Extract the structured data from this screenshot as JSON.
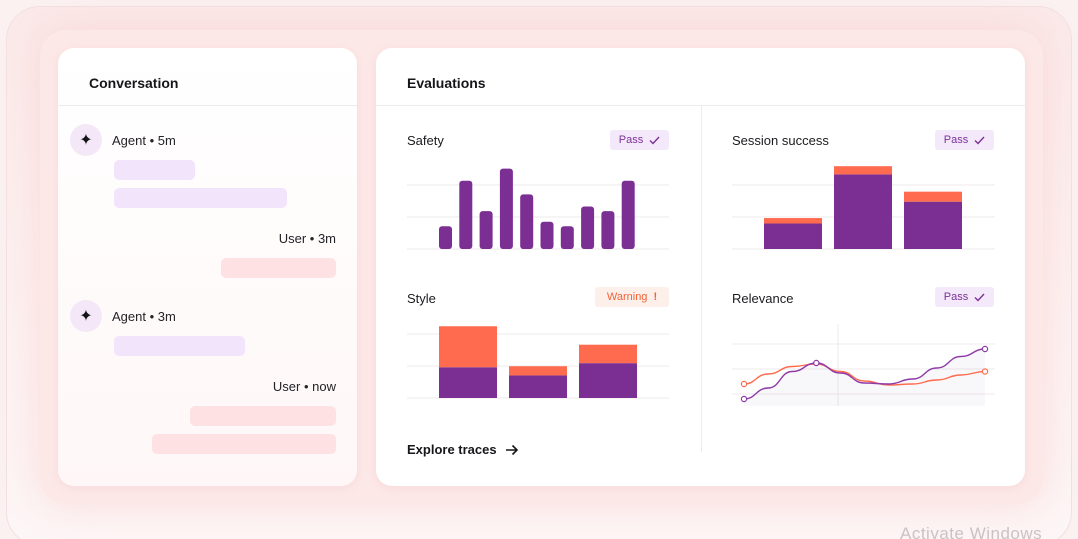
{
  "conversation": {
    "title": "Conversation",
    "messages": [
      {
        "role": "agent",
        "label": "Agent • 5m"
      },
      {
        "role": "user",
        "label": "User • 3m"
      },
      {
        "role": "agent",
        "label": "Agent • 3m"
      },
      {
        "role": "user",
        "label": "User • now"
      }
    ]
  },
  "evaluations": {
    "title": "Evaluations",
    "explore_label": "Explore traces",
    "panels": [
      {
        "name": "Safety",
        "badge": "Pass",
        "status": "pass"
      },
      {
        "name": "Session success",
        "badge": "Pass",
        "status": "pass"
      },
      {
        "name": "Style",
        "badge": "Warning",
        "status": "warning"
      },
      {
        "name": "Relevance",
        "badge": "Pass",
        "status": "pass"
      }
    ]
  },
  "colors": {
    "purple": "#7b2f93",
    "orange": "#ff6b4e",
    "pass_bg": "#f4e9fb",
    "warn_bg": "#fdf0ea"
  },
  "icons": {
    "agent_avatar": "sparkle-icon",
    "pass": "check-icon",
    "warning": "exclamation-icon",
    "explore": "arrow-right-icon"
  },
  "watermark": "Activate Windows",
  "chart_data": [
    {
      "type": "bar",
      "name": "safety",
      "values": [
        1.5,
        4.5,
        2.5,
        5.3,
        3.6,
        1.8,
        1.5,
        2.8,
        2.5,
        4.5
      ],
      "ylim": [
        0,
        6
      ]
    },
    {
      "type": "bar",
      "name": "session-success",
      "stacked": true,
      "categories": [
        "a",
        "b",
        "c"
      ],
      "series": [
        {
          "values": [
            1.4,
            4.1,
            2.6
          ]
        },
        {
          "values": [
            0.3,
            0.45,
            0.55
          ]
        }
      ],
      "ylim": [
        0,
        5
      ]
    },
    {
      "type": "bar",
      "name": "style",
      "stacked": true,
      "categories": [
        "a",
        "b",
        "c"
      ],
      "series": [
        {
          "values": [
            1.5,
            1.1,
            1.7
          ]
        },
        {
          "values": [
            2.0,
            0.45,
            0.9
          ]
        }
      ],
      "ylim": [
        0,
        4
      ]
    },
    {
      "type": "line",
      "name": "relevance",
      "x": [
        0,
        0.1,
        0.2,
        0.3,
        0.4,
        0.5,
        0.6,
        0.7,
        0.8,
        0.9,
        1.0
      ],
      "series": [
        {
          "values": [
            0.0,
            0.22,
            0.55,
            0.72,
            0.52,
            0.32,
            0.3,
            0.4,
            0.62,
            0.85,
            1.0
          ]
        },
        {
          "values": [
            0.3,
            0.5,
            0.65,
            0.7,
            0.55,
            0.36,
            0.28,
            0.3,
            0.38,
            0.48,
            0.55
          ]
        }
      ],
      "ylim": [
        0,
        1
      ]
    }
  ]
}
